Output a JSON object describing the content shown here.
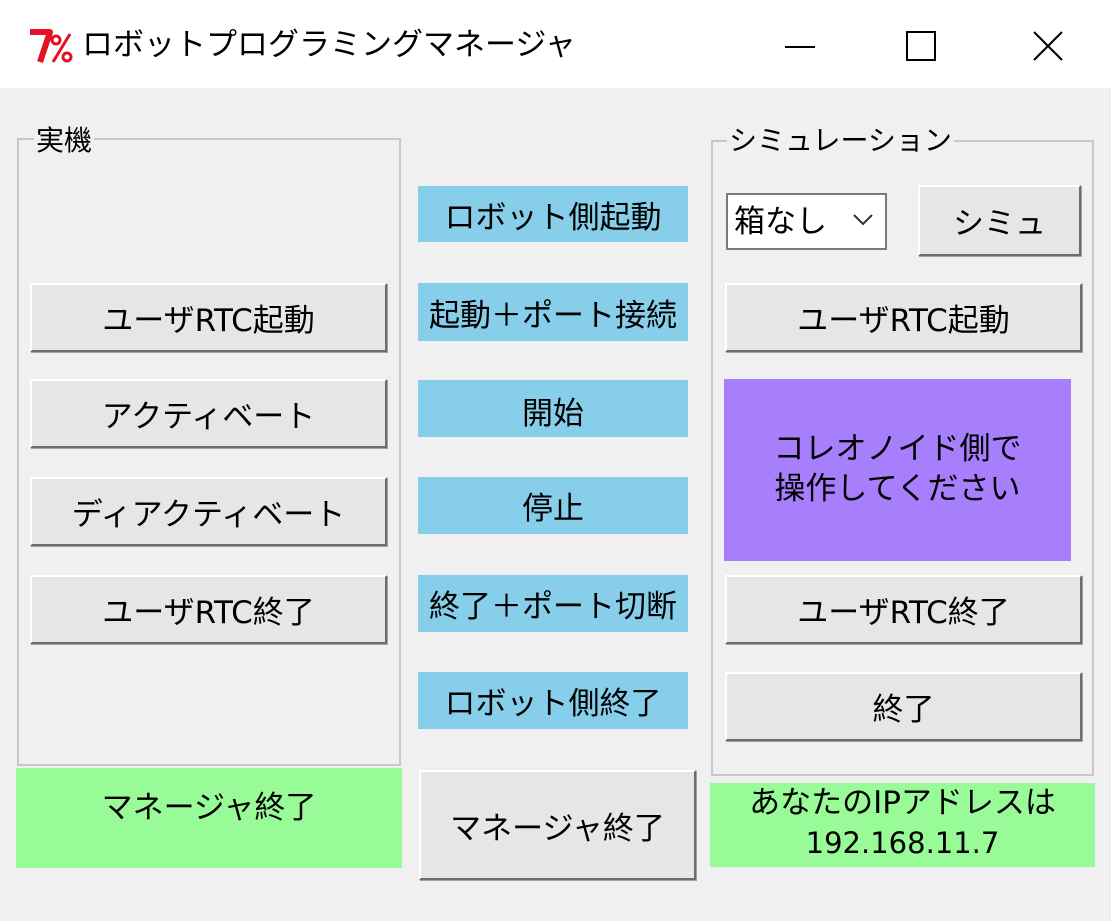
{
  "window": {
    "title": "ロボットプログラミングマネージャ",
    "logo_text": "7%",
    "controls": [
      "minimize-icon",
      "maximize-icon",
      "close-icon"
    ]
  },
  "real_machine": {
    "group_label": "実機",
    "buttons": {
      "start_user_rtc": "ユーザRTC起動",
      "activate": "アクティベート",
      "deactivate": "ディアクティベート",
      "stop_user_rtc": "ユーザRTC終了"
    },
    "status": "マネージャ終了"
  },
  "center": {
    "buttons": {
      "robot_start": "ロボット側起動",
      "start_connect": "起動＋ポート接続",
      "begin": "開始",
      "stop": "停止",
      "end_disconnect": "終了＋ポート切断",
      "robot_end": "ロボット側終了"
    },
    "manager_end": "マネージャ終了"
  },
  "simulation": {
    "group_label": "シミュレーション",
    "select": {
      "selected": "箱なし"
    },
    "sim_button": "シミュ",
    "start_user_rtc": "ユーザRTC起動",
    "message": [
      "コレオノイド側で",
      "操作してください"
    ],
    "stop_user_rtc": "ユーザRTC終了",
    "end_button": "終了",
    "ip_label": "あなたのIPアドレスは",
    "ip_address": "192.168.11.7"
  },
  "colors": {
    "flat_button": "#87ceeb",
    "status_green": "#98fb98",
    "message_purple": "#a77ffd",
    "logo_red": "#e81123"
  }
}
